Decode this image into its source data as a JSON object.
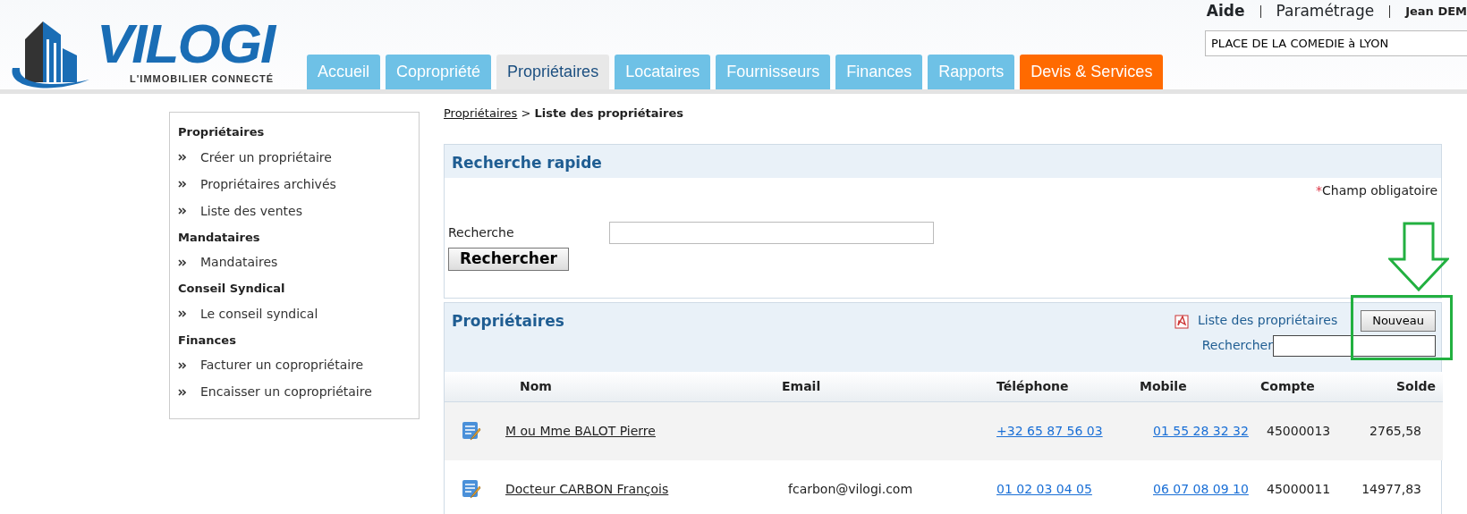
{
  "logo": {
    "name": "VILOGI",
    "tagline": "L'IMMOBILIER CONNECTÉ"
  },
  "top_links": [
    {
      "label": "Aide",
      "kind": "strong"
    },
    {
      "label": "Paramétrage",
      "kind": "plain"
    },
    {
      "label": "Jean DEM",
      "kind": "user"
    }
  ],
  "building_field": {
    "value": "PLACE DE LA COMEDIE à LYON"
  },
  "tabs": [
    {
      "label": "Accueil",
      "selected": false,
      "kind": "normal"
    },
    {
      "label": "Copropriété",
      "selected": false,
      "kind": "normal"
    },
    {
      "label": "Propriétaires",
      "selected": true,
      "kind": "normal"
    },
    {
      "label": "Locataires",
      "selected": false,
      "kind": "normal"
    },
    {
      "label": "Fournisseurs",
      "selected": false,
      "kind": "normal"
    },
    {
      "label": "Finances",
      "selected": false,
      "kind": "normal"
    },
    {
      "label": "Rapports",
      "selected": false,
      "kind": "normal"
    },
    {
      "label": "Devis & Services",
      "selected": false,
      "kind": "service"
    }
  ],
  "sidebar": {
    "sections": [
      {
        "heading": "Propriétaires",
        "items": [
          "Créer un propriétaire",
          "Propriétaires archivés",
          "Liste des ventes"
        ]
      },
      {
        "heading": "Mandataires",
        "items": [
          "Mandataires"
        ]
      },
      {
        "heading": "Conseil Syndical",
        "items": [
          "Le conseil syndical"
        ]
      },
      {
        "heading": "Finances",
        "items": [
          "Facturer un copropriétaire",
          "Encaisser un copropriétaire"
        ]
      }
    ]
  },
  "breadcrumb": {
    "link": "Propriétaires",
    "separator": ">",
    "current": "Liste des propriétaires"
  },
  "quick_search": {
    "title": "Recherche rapide",
    "required_mark": "*",
    "required_note": "Champ obligatoire",
    "field_label": "Recherche",
    "button": "Rechercher"
  },
  "owners": {
    "title": "Propriétaires",
    "pdf_link": "Liste des propriétaires",
    "new_button": "Nouveau",
    "search_label": "Rechercher",
    "table": {
      "columns": [
        "Nom",
        "Email",
        "Téléphone",
        "Mobile",
        "Compte",
        "Solde"
      ],
      "rows": [
        {
          "name": "M ou Mme BALOT Pierre",
          "email": "",
          "phone": "+32 65 87 56 03",
          "mobile": "01 55 28 32 32",
          "account": "45000013",
          "balance": "2765,58"
        },
        {
          "name": "Docteur CARBON François",
          "email": "fcarbon@vilogi.com",
          "phone": "01 02 03 04 05",
          "mobile": "06 07 08 09 10",
          "account": "45000011",
          "balance": "14977,83"
        }
      ]
    }
  },
  "annotation": {
    "kind": "arrow-and-frame"
  }
}
